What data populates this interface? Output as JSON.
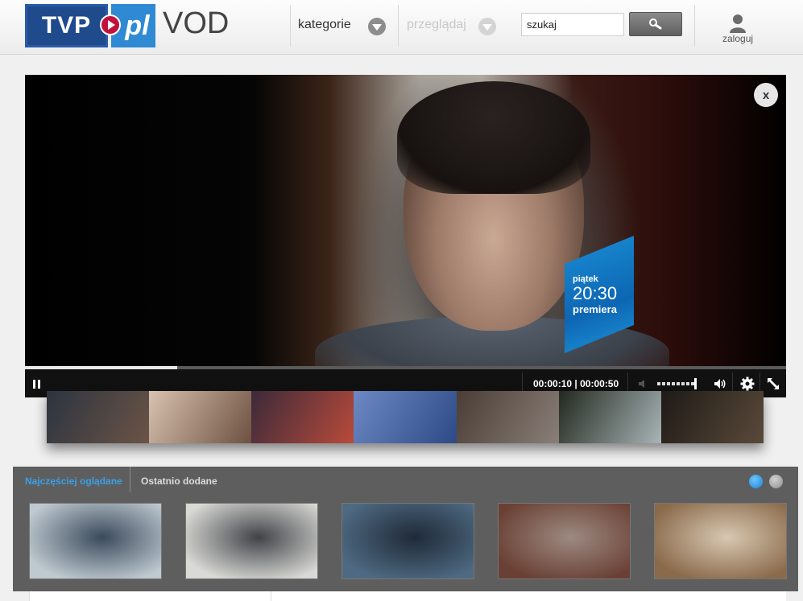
{
  "header": {
    "logo_tvp": "TVP",
    "logo_pl": "pl",
    "logo_vod": "VOD",
    "menu": [
      {
        "label": "kategorie",
        "enabled": true
      },
      {
        "label": "przeglądaj",
        "enabled": false
      }
    ],
    "search": {
      "value": "szukaj"
    },
    "login_label": "zaloguj"
  },
  "player": {
    "promo": {
      "day": "piątek",
      "time": "20:30",
      "label": "premiera"
    },
    "close_label": "x",
    "progress": 0.2,
    "current_time": "00:00:10",
    "duration": "00:00:50",
    "time_separator": "|",
    "volume": 0.9
  },
  "strip": {
    "thumbs": [
      {
        "colors": [
          "#2c3440",
          "#6b5446"
        ]
      },
      {
        "colors": [
          "#d8c2b0",
          "#6e5140"
        ]
      },
      {
        "colors": [
          "#3b2a3a",
          "#b94a3a"
        ]
      },
      {
        "colors": [
          "#6c89c4",
          "#2e4a86"
        ]
      },
      {
        "colors": [
          "#4a3d36",
          "#8a7f78"
        ]
      },
      {
        "colors": [
          "#22291f",
          "#a8b4b6"
        ]
      },
      {
        "colors": [
          "#1e1a16",
          "#5a4a3a"
        ]
      }
    ]
  },
  "bottom": {
    "tabs": [
      {
        "label": "Najczęściej oglądane",
        "active": true
      },
      {
        "label": "Ostatnio dodane",
        "active": false
      }
    ],
    "pager": {
      "current": 1,
      "total": 2
    },
    "cards": [
      {
        "colors": [
          "#bfc9d0",
          "#3a4a5c"
        ]
      },
      {
        "colors": [
          "#d9dad6",
          "#404247"
        ]
      },
      {
        "colors": [
          "#4e6a82",
          "#1f2a38"
        ]
      },
      {
        "colors": [
          "#6a4034",
          "#9d8a82"
        ]
      },
      {
        "colors": [
          "#8a6a4a",
          "#d8c8b2"
        ]
      }
    ]
  },
  "colors": {
    "accent": "#3aa0e8",
    "tvp_blue": "#1f4a8c",
    "pl_blue": "#2f8ad3",
    "play_red": "#c0123d"
  }
}
